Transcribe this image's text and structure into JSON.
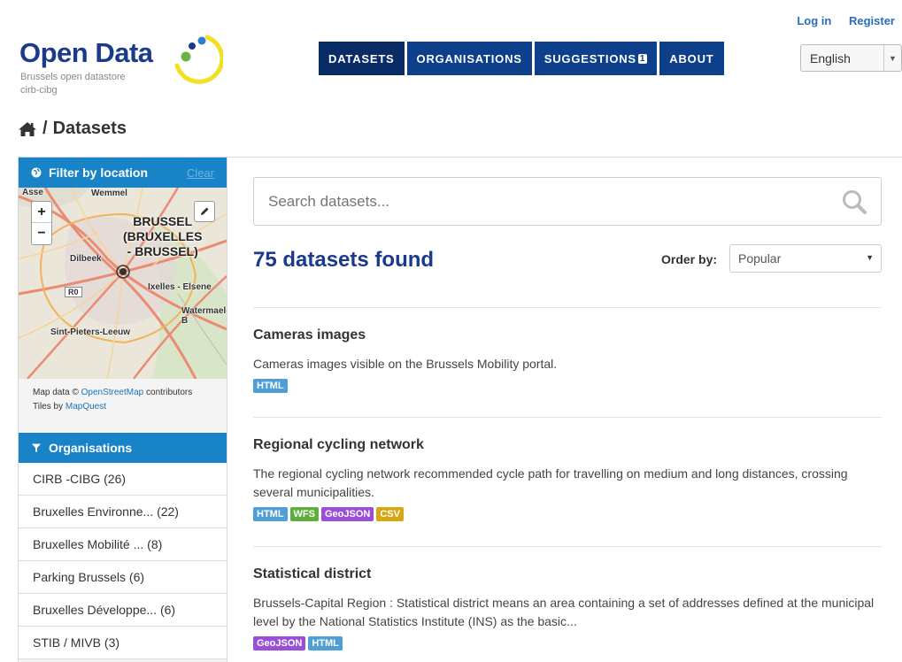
{
  "header": {
    "logo_title": "Open Data",
    "logo_subtitle": "Brussels open datastore",
    "logo_org": "cirb-cibg",
    "login": "Log in",
    "register": "Register",
    "language": "English"
  },
  "nav": [
    {
      "label": "DATASETS"
    },
    {
      "label": "ORGANISATIONS"
    },
    {
      "label": "SUGGESTIONS",
      "badge": "1"
    },
    {
      "label": "ABOUT"
    }
  ],
  "breadcrumb": {
    "separator": "/",
    "current": "Datasets"
  },
  "sidebar": {
    "location_title": "Filter by location",
    "clear": "Clear",
    "map_labels": {
      "asse": "Asse",
      "wemmel": "Wemmel",
      "brussel": "BRUSSEL\n(BRUXELLES\n- BRUSSEL)",
      "dilbeek": "Dilbeek",
      "r0": "R0",
      "ixelles": "Ixelles - Elsene",
      "watermael": "Watermael-B",
      "sint_pieters": "Sint-Pieters-Leeuw"
    },
    "map_credit_prefix": "Map data ©",
    "map_credit_link": "OpenStreetMap",
    "map_credit_suffix": "contributors",
    "tiles_prefix": "Tiles by",
    "tiles_link": "MapQuest",
    "org_title": "Organisations",
    "orgs": [
      "CIRB -CIBG (26)",
      "Bruxelles Environne... (22)",
      "Bruxelles Mobilité ... (8)",
      "Parking Brussels (6)",
      "Bruxelles Développe... (6)",
      "STIB / MIVB (3)"
    ]
  },
  "main": {
    "search_placeholder": "Search datasets...",
    "count": "75 datasets found",
    "order_label": "Order by:",
    "order_value": "Popular",
    "datasets": [
      {
        "title": "Cameras images",
        "notes": "Cameras images visible on the Brussels Mobility portal.",
        "tags": [
          "HTML"
        ]
      },
      {
        "title": "Regional cycling network",
        "notes": "The regional cycling network recommended cycle path for travelling on medium and long distances, crossing several municipalities.",
        "tags": [
          "HTML",
          "WFS",
          "GeoJSON",
          "CSV"
        ]
      },
      {
        "title": "Statistical district",
        "notes": "Brussels-Capital Region : Statistical district means an area containing a set of addresses defined at the municipal level by the National Statistics Institute (INS) as the basic...",
        "tags": [
          "GeoJSON",
          "HTML"
        ]
      }
    ]
  },
  "colors": {
    "brand_navy": "#0e3f8a",
    "sidebar_blue": "#1884c7",
    "title_blue": "#1b3a8c",
    "tag_html": "#4e9fd6",
    "tag_wfs": "#5fad3c",
    "tag_geojson": "#9a4fd8",
    "tag_csv": "#d9a613"
  },
  "icons": {
    "home": "home-icon",
    "globe": "globe-icon",
    "filter": "filter-icon",
    "search": "search-icon",
    "pencil": "pencil-icon"
  }
}
